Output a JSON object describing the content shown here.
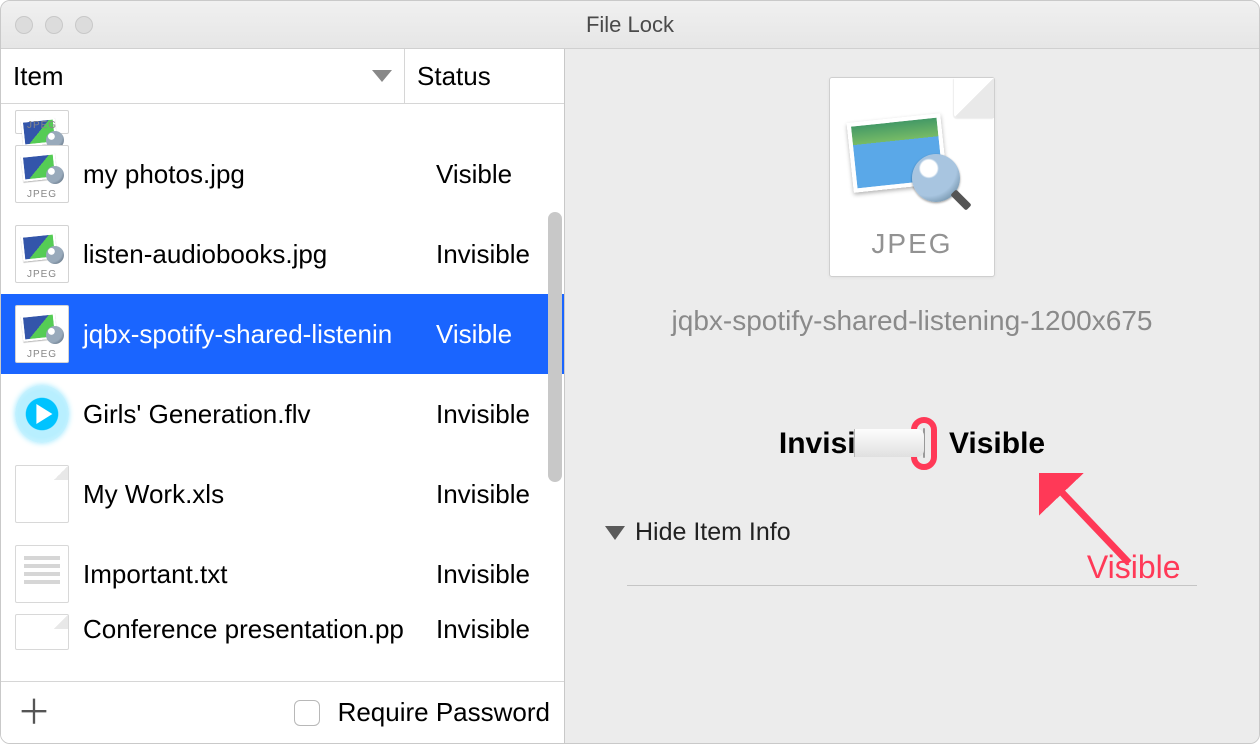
{
  "window": {
    "title": "File Lock"
  },
  "table": {
    "headers": {
      "item": "Item",
      "status": "Status"
    }
  },
  "files": [
    {
      "name": "my photos.jpg",
      "status": "Visible",
      "icon": "jpeg"
    },
    {
      "name": "listen-audiobooks.jpg",
      "status": "Invisible",
      "icon": "jpeg"
    },
    {
      "name": "jqbx-spotify-shared-listenin",
      "status": "Visible",
      "icon": "jpeg",
      "selected": true
    },
    {
      "name": "Girls' Generation.flv",
      "status": "Invisible",
      "icon": "flv"
    },
    {
      "name": "My Work.xls",
      "status": "Invisible",
      "icon": "blank"
    },
    {
      "name": "Important.txt",
      "status": "Invisible",
      "icon": "txt"
    },
    {
      "name": "Conference presentation.pp",
      "status": "Invisible",
      "icon": "blank"
    }
  ],
  "footer": {
    "require_password": "Require Password"
  },
  "detail": {
    "filetype_tag": "JPEG",
    "filename": "jqbx-spotify-shared-listening-1200x675",
    "invisible": "Invisible",
    "visible": "Visible",
    "hide_info": "Hide Item Info"
  },
  "annotation": {
    "label": "Visible",
    "color": "#ff3957"
  }
}
